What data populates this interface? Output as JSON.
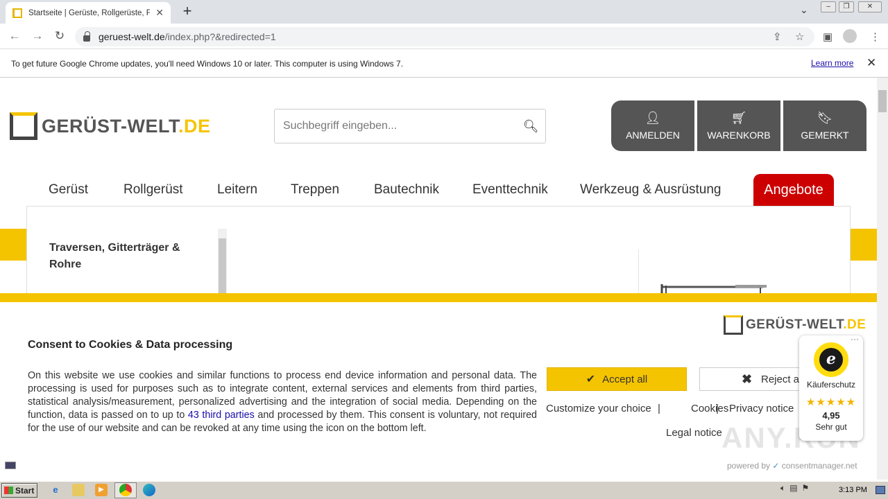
{
  "browser": {
    "tab_title": "Startseite | Gerüste, Rollgerüste, Fa",
    "url_domain": "geruest-welt.de",
    "url_path": "/index.php?&redirected=1",
    "infobar_text": "To get future Google Chrome updates, you'll need Windows 10 or later. This computer is using Windows 7.",
    "learn_more": "Learn more"
  },
  "header": {
    "logo_main": "GERÜST-WELT",
    "logo_tld": ".DE",
    "search_placeholder": "Suchbegriff eingeben...",
    "buttons": [
      {
        "label": "ANMELDEN",
        "icon": "user-icon"
      },
      {
        "label": "WARENKORB",
        "icon": "cart-icon"
      },
      {
        "label": "GEMERKT",
        "icon": "bookmark-icon"
      }
    ]
  },
  "nav": {
    "items": [
      "Gerüst",
      "Rollgerüst",
      "Leitern",
      "Treppen",
      "Bautechnik",
      "Eventtechnik",
      "Werkzeug & Ausrüstung"
    ],
    "offers": "Angebote"
  },
  "mega": {
    "category": "Traversen, Gitterträger & Rohre"
  },
  "cookie": {
    "logo_main": "GERÜST-WELT",
    "logo_tld": ".DE",
    "title": "Consent to Cookies & Data processing",
    "text_before": "On this website we use cookies and similar functions to process end device information and personal data. The processing is used for purposes such as to integrate content, external services and elements from third parties, statistical analysis/measurement, personalized advertising and the integration of social media. Depending on the function, data is passed on to up to ",
    "third_parties_link": "43 third parties",
    "text_after": " and processed by them. This consent is voluntary, not required for the use of our website and can be revoked at any time using the icon on the bottom left.",
    "accept": "Accept all",
    "reject": "Reject all",
    "links": [
      "Customize your choice",
      "Cookies",
      "Privacy notice"
    ],
    "legal": "Legal notice",
    "powered_by": "powered by",
    "powered_brand": "consentmanager.net"
  },
  "trusted_shops": {
    "label": "Käuferschutz",
    "score": "4,95",
    "grade": "Sehr gut",
    "rating": 5
  },
  "watermark": "ANY.RUN",
  "taskbar": {
    "start": "Start",
    "clock": "3:13 PM"
  },
  "colors": {
    "brand_yellow": "#f5c400",
    "offers_red": "#cc0000",
    "header_button": "#555555"
  }
}
